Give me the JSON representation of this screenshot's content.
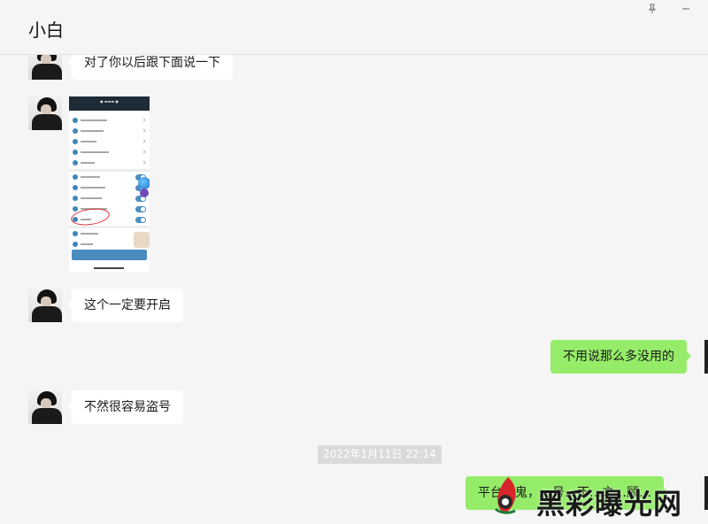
{
  "window": {
    "title": "小白",
    "icons": {
      "pin": "pin-icon",
      "minimize": "minimize-icon"
    }
  },
  "messages": [
    {
      "side": "left",
      "text": "对了你以后跟下面说一下"
    },
    {
      "side": "left",
      "type": "image",
      "content": "phone-settings-screenshot"
    },
    {
      "side": "left",
      "text": "这个一定要开启"
    },
    {
      "side": "right",
      "text": "不用说那么多没用的"
    },
    {
      "side": "left",
      "text": "不然很容易盗号"
    },
    {
      "type": "timestamp",
      "text": "2022年1月11日 22:14"
    },
    {
      "side": "right",
      "text": "平台没鬼，…号…不…之…顾…"
    }
  ],
  "watermark": {
    "text": "黑彩曝光网"
  },
  "colors": {
    "background": "#f5f5f5",
    "incoming_bubble": "#ffffff",
    "outgoing_bubble": "#95ec69",
    "timestamp_bg": "#dadada"
  }
}
